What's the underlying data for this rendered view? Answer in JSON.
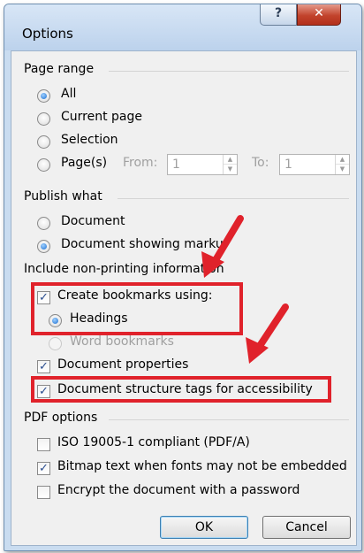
{
  "window": {
    "title": "Options",
    "help_glyph": "?",
    "close_glyph": "✕"
  },
  "page_range": {
    "title": "Page range",
    "options": [
      "All",
      "Current page",
      "Selection",
      "Page(s)"
    ],
    "selected": "All",
    "from_label": "From:",
    "from_value": "1",
    "to_label": "To:",
    "to_value": "1"
  },
  "publish_what": {
    "title": "Publish what",
    "options": [
      "Document",
      "Document showing marku"
    ],
    "selected": "Document showing marku"
  },
  "non_printing": {
    "title": "Include non-printing information",
    "create_bookmarks_label": "Create bookmarks using:",
    "create_bookmarks_checked": true,
    "headings_label": "Headings",
    "word_bookmarks_label": "Word bookmarks",
    "document_properties_label": "Document properties",
    "document_properties_checked": true,
    "structure_tags_label": "Document structure tags for accessibility",
    "structure_tags_checked": true
  },
  "pdf_options": {
    "title": "PDF options",
    "iso_label": "ISO 19005-1 compliant (PDF/A)",
    "iso_checked": false,
    "bitmap_label": "Bitmap text when fonts may not be embedded",
    "bitmap_checked": true,
    "encrypt_label": "Encrypt the document with a password",
    "encrypt_checked": false
  },
  "buttons": {
    "ok": "OK",
    "cancel": "Cancel"
  },
  "annotation": {
    "color": "#e0222b"
  }
}
